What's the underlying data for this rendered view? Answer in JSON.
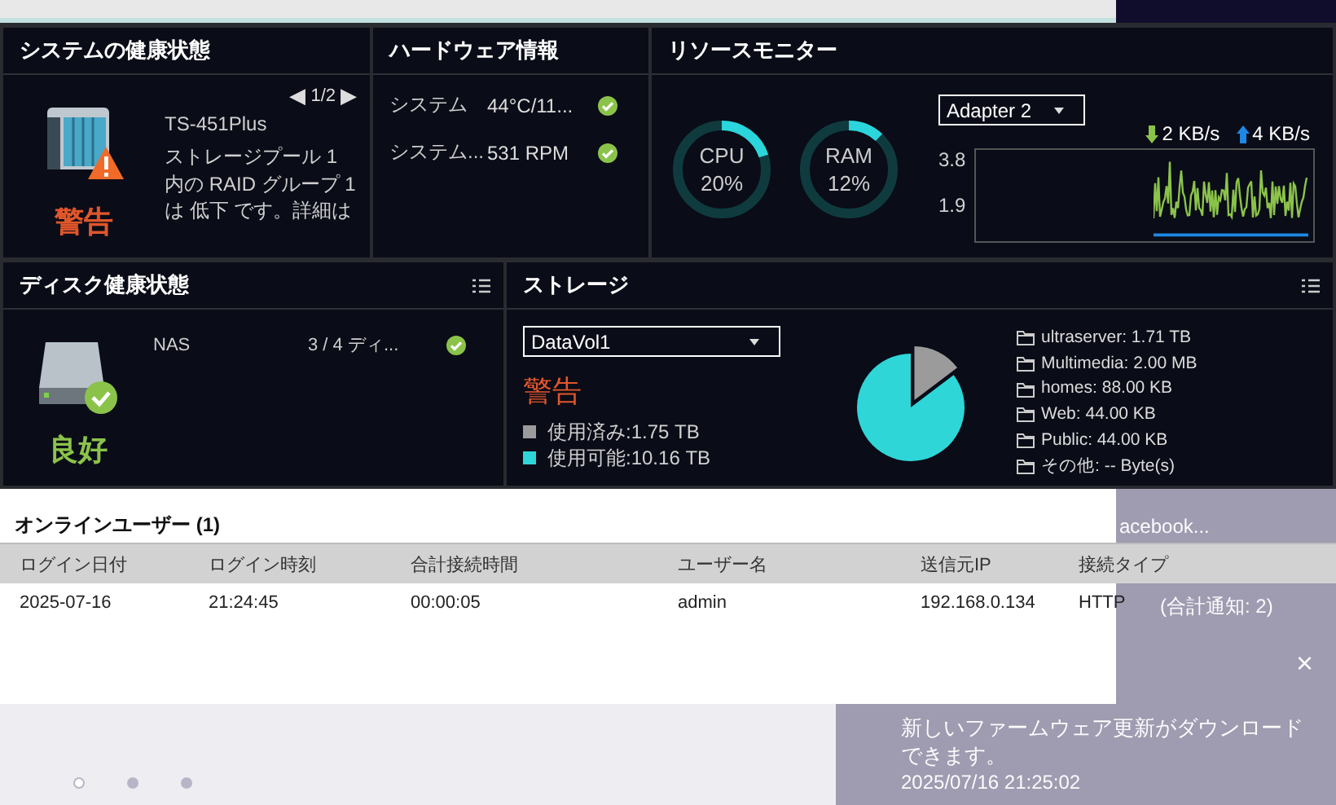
{
  "system_health": {
    "title": "システムの健康状態",
    "pager": {
      "prev": "◀",
      "page": "1/2",
      "next": "▶"
    },
    "status": "警告",
    "model": "TS-451Plus",
    "message": "ストレージプール 1 内の RAID グループ 1 は 低下 です。詳細は"
  },
  "hardware_info": {
    "title": "ハードウェア情報",
    "rows": [
      {
        "name": "システム",
        "value": "44°C/11...",
        "ok": true
      },
      {
        "name": "システム...",
        "value": "531 RPM",
        "ok": true
      }
    ]
  },
  "resource_monitor": {
    "title": "リソースモニター",
    "gauges": [
      {
        "name": "CPU",
        "reading": "20%",
        "level": 0.2
      },
      {
        "name": "RAM",
        "reading": "12%",
        "level": 0.12
      }
    ],
    "adapter": {
      "value": "Adapter 2"
    },
    "download": "2 KB/s",
    "upload": "4 KB/s",
    "y_labels": [
      "3.8",
      "1.9"
    ]
  },
  "disk_health": {
    "title": "ディスク健康状態",
    "status": "良好",
    "rows": [
      {
        "name": "NAS",
        "value": "3 / 4 ディ...",
        "ok": true
      }
    ]
  },
  "storage": {
    "title": "ストレージ",
    "volume": {
      "value": "DataVol1"
    },
    "status": "警告",
    "legend": [
      {
        "color": "#9b9b9b"
      },
      {
        "color": "#2ed6d8"
      }
    ],
    "chart_data": {
      "type": "pie",
      "categories": [
        "使用済み:1.75 TB",
        "使用可能:10.16 TB"
      ],
      "values": [
        1.75,
        10.16
      ]
    },
    "folders": [
      "ultraserver: 1.71 TB",
      "Multimedia: 2.00 MB",
      "homes: 88.00 KB",
      "Web: 44.00 KB",
      "Public: 44.00 KB",
      "その他: -- Byte(s)"
    ]
  },
  "online_users": {
    "title": "オンラインユーザー (1)",
    "columns": [
      "ログイン日付",
      "ログイン時刻",
      "合計接続時間",
      "ユーザー名",
      "送信元IP",
      "接続タイプ"
    ],
    "rows": [
      [
        "2025-07-16",
        "21:24:45",
        "00:00:05",
        "admin",
        "192.168.0.134",
        "HTTP"
      ]
    ]
  },
  "notifications": {
    "partial_text": "acebook...",
    "total": "(合計通知: 2)",
    "close": "×",
    "message": "新しいファームウェア更新がダウンロードできます。",
    "time": "2025/07/16 21:25:02"
  },
  "pager_dots": [
    {
      "selected": true
    },
    {
      "selected": false
    },
    {
      "selected": false
    }
  ]
}
